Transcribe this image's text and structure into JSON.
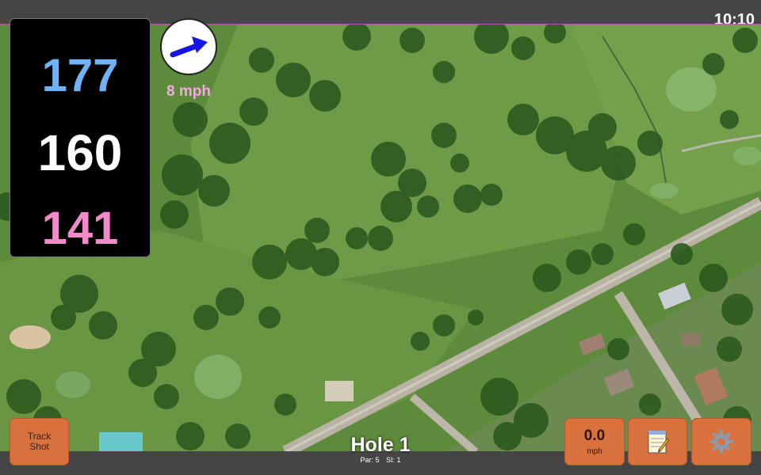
{
  "status": {
    "time": "10:10"
  },
  "distances": {
    "back": "177",
    "middle": "160",
    "front": "141"
  },
  "wind": {
    "speed": "8 mph",
    "arrow_icon": "wind-direction-arrow",
    "arrow_color": "#1515e6"
  },
  "hole": {
    "title": "Hole 1",
    "par": "Par: 5",
    "si": "SI: 1"
  },
  "buttons": {
    "track_shot": "Track\nShot",
    "speed_value": "0.0",
    "speed_unit": "mph",
    "notes_icon": "notepad-icon",
    "settings_icon": "gear-icon"
  },
  "colors": {
    "back_distance": "#6fb2f5",
    "middle_distance": "#ffffff",
    "front_distance": "#f08acb",
    "button": "#d9713f"
  }
}
